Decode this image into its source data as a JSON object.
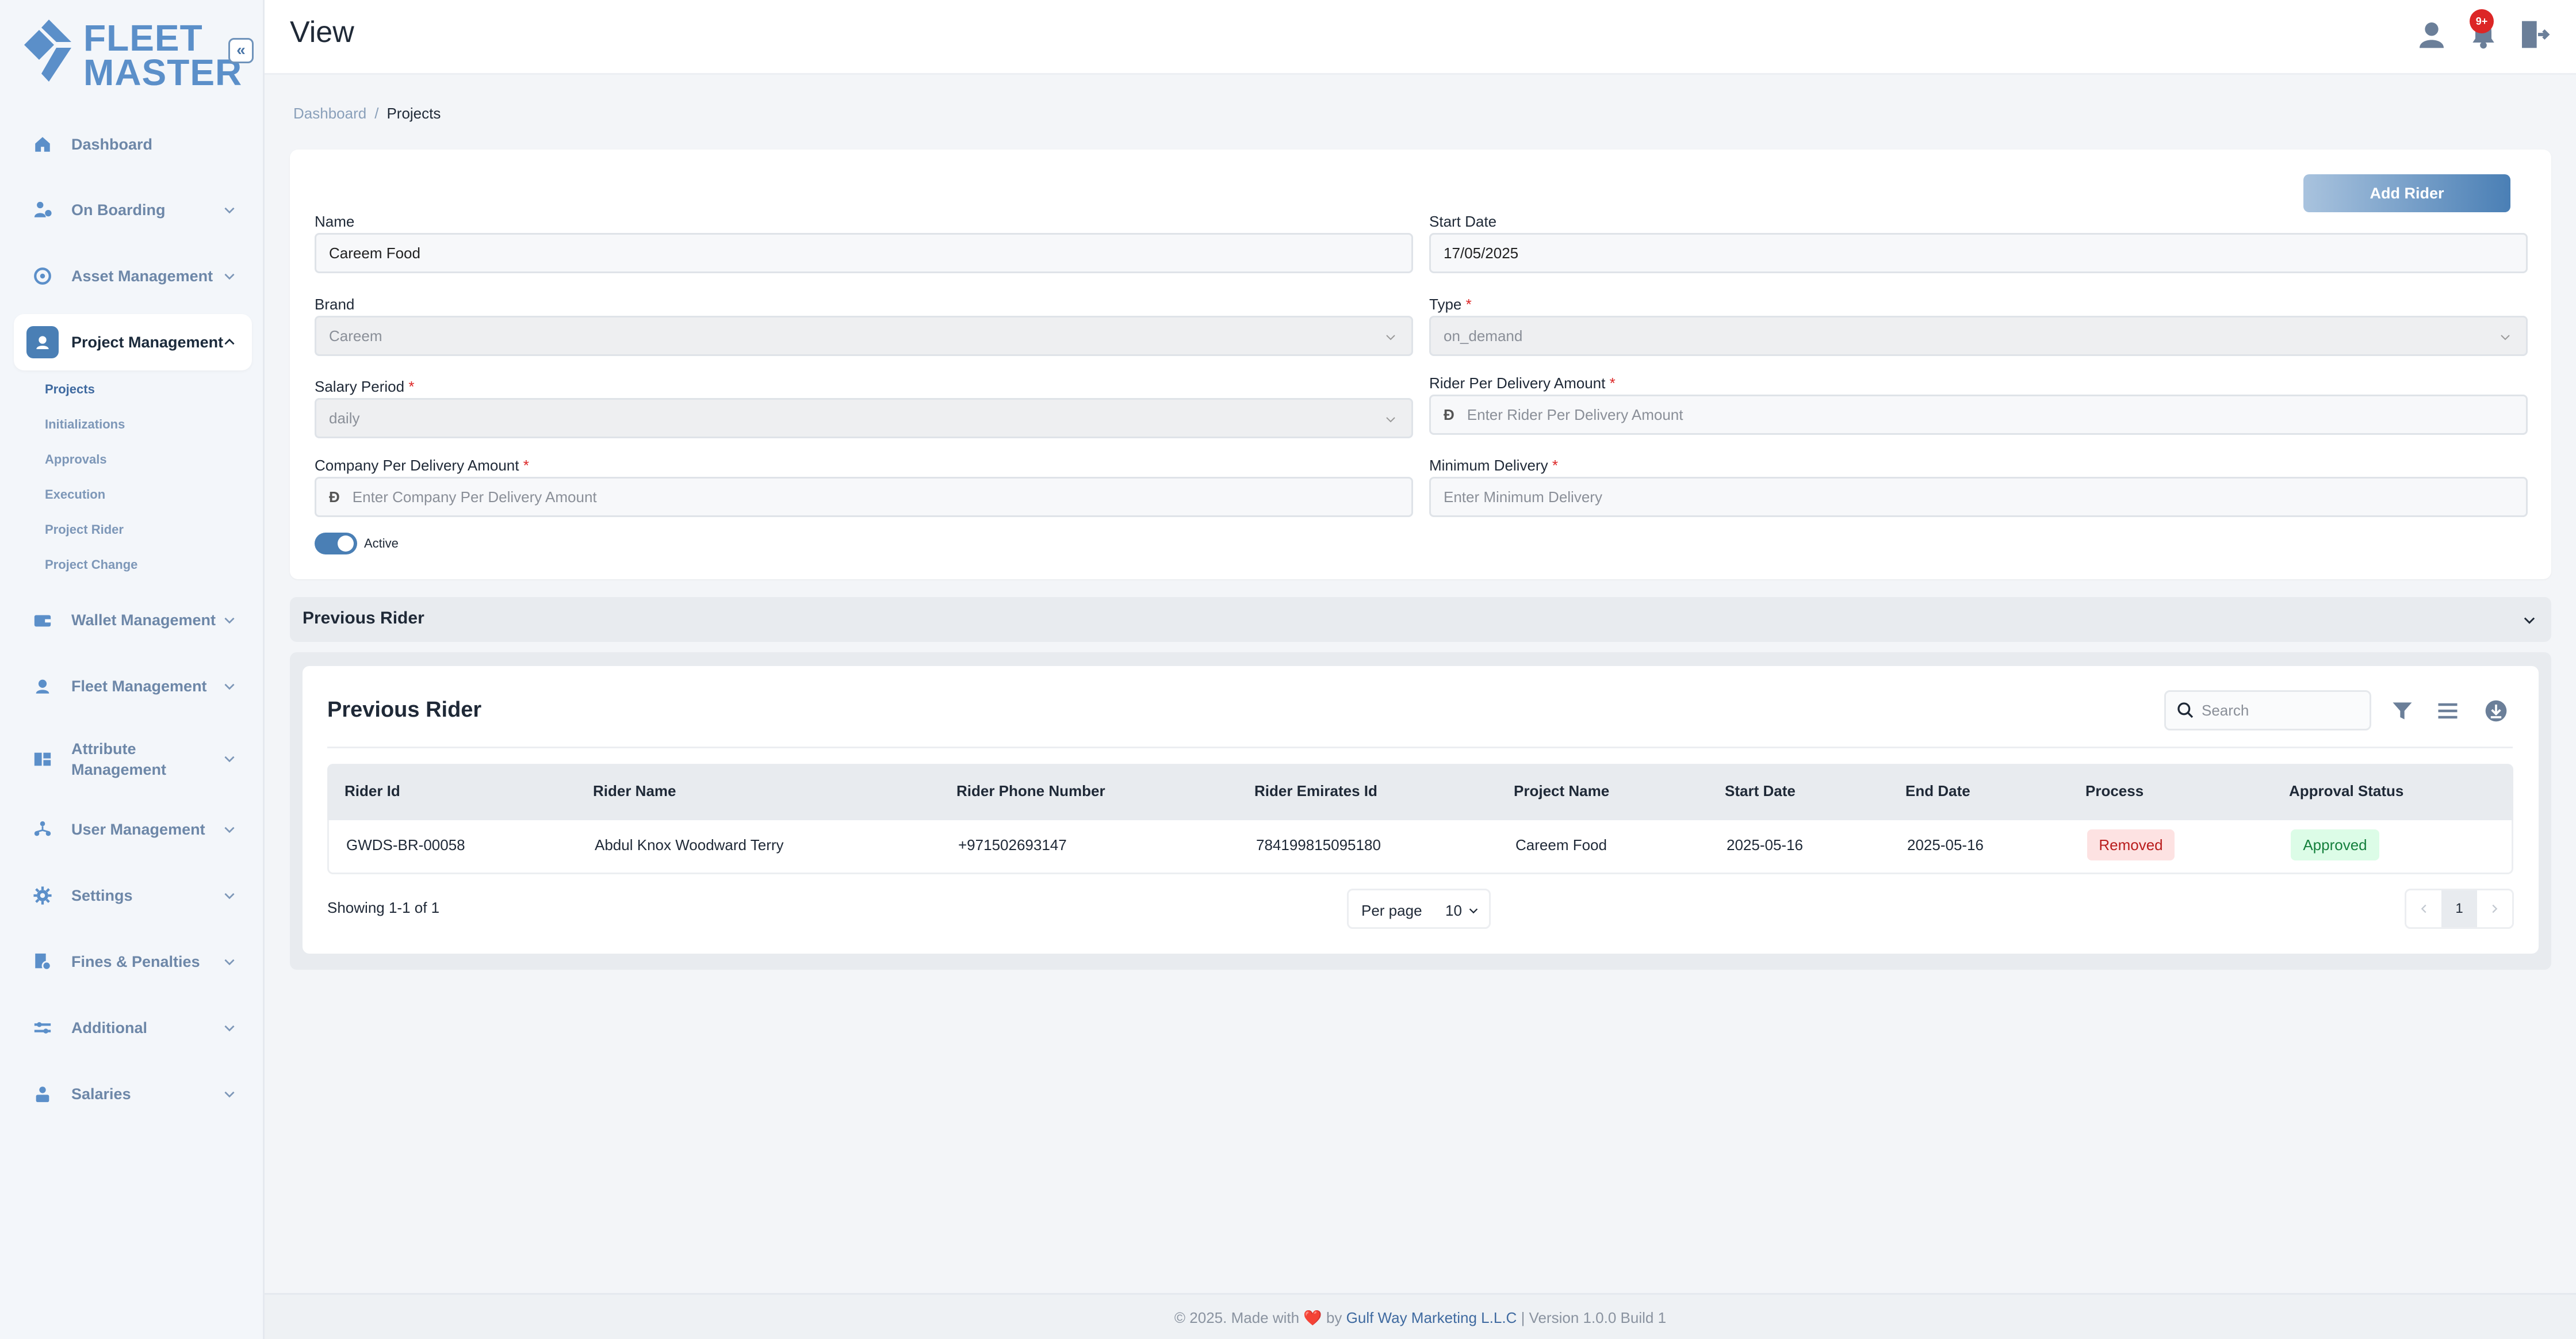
{
  "app": {
    "logo_line1": "FLEET",
    "logo_line2": "MASTER",
    "collapse_glyph": "«"
  },
  "header": {
    "title": "View",
    "notification_badge": "9+"
  },
  "sidebar": {
    "items": [
      {
        "label": "Dashboard",
        "icon": "home-icon"
      },
      {
        "label": "On Boarding",
        "icon": "onboarding-icon"
      },
      {
        "label": "Asset Management",
        "icon": "asset-icon"
      },
      {
        "label": "Project Management",
        "icon": "project-icon",
        "active": true
      },
      {
        "label": "Wallet Management",
        "icon": "wallet-icon"
      },
      {
        "label": "Fleet Management",
        "icon": "fleet-icon"
      },
      {
        "label": "Attribute Management",
        "icon": "attribute-icon"
      },
      {
        "label": "User Management",
        "icon": "users-icon"
      },
      {
        "label": "Settings",
        "icon": "gear-icon"
      },
      {
        "label": "Fines & Penalties",
        "icon": "fines-icon"
      },
      {
        "label": "Additional",
        "icon": "additional-icon"
      },
      {
        "label": "Salaries",
        "icon": "salaries-icon"
      }
    ],
    "subitems": [
      "Projects",
      "Initializations",
      "Approvals",
      "Execution",
      "Project Rider",
      "Project Change"
    ]
  },
  "breadcrumb": {
    "parent": "Dashboard",
    "separator": "/",
    "current": "Projects"
  },
  "form": {
    "add_button": "Add Rider",
    "name": {
      "label": "Name",
      "value": "Careem Food"
    },
    "start_date": {
      "label": "Start Date",
      "value": "17/05/2025"
    },
    "brand": {
      "label": "Brand",
      "value": "Careem"
    },
    "type": {
      "label": "Type",
      "value": "on_demand"
    },
    "salary_period": {
      "label": "Salary Period",
      "value": "daily"
    },
    "rider_amount": {
      "label": "Rider Per Delivery Amount",
      "placeholder": "Enter Rider Per Delivery Amount"
    },
    "company_amount": {
      "label": "Company Per Delivery Amount",
      "placeholder": "Enter Company Per Delivery Amount"
    },
    "min_delivery": {
      "label": "Minimum Delivery",
      "placeholder": "Enter Minimum Delivery"
    },
    "required_mark": "*",
    "currency_symbol": "Ð",
    "active_label": "Active"
  },
  "accordion": {
    "title": "Previous Rider"
  },
  "table": {
    "title": "Previous Rider",
    "search_placeholder": "Search",
    "columns": [
      "Rider Id",
      "Rider Name",
      "Rider Phone Number",
      "Rider Emirates Id",
      "Project Name",
      "Start Date",
      "End Date",
      "Process",
      "Approval Status"
    ],
    "rows": [
      {
        "rider_id": "GWDS-BR-00058",
        "rider_name": "Abdul Knox Woodward Terry",
        "phone": "+971502693147",
        "emirates_id": "784199815095180",
        "project": "Careem Food",
        "start": "2025-05-16",
        "end": "2025-05-16",
        "process": "Removed",
        "approval": "Approved"
      }
    ],
    "showing": "Showing 1-1 of 1",
    "per_page_label": "Per page",
    "per_page_value": "10",
    "current_page": "1"
  },
  "footer": {
    "prefix": "© 2025. Made with",
    "heart": "❤️",
    "by": "by",
    "company": "Gulf Way Marketing L.L.C",
    "version": "| Version 1.0.0 Build 1"
  },
  "colors": {
    "accent": "#4a7fb5",
    "removed": "#b91c1c",
    "approved": "#15803d",
    "badge": "#dc2626"
  }
}
